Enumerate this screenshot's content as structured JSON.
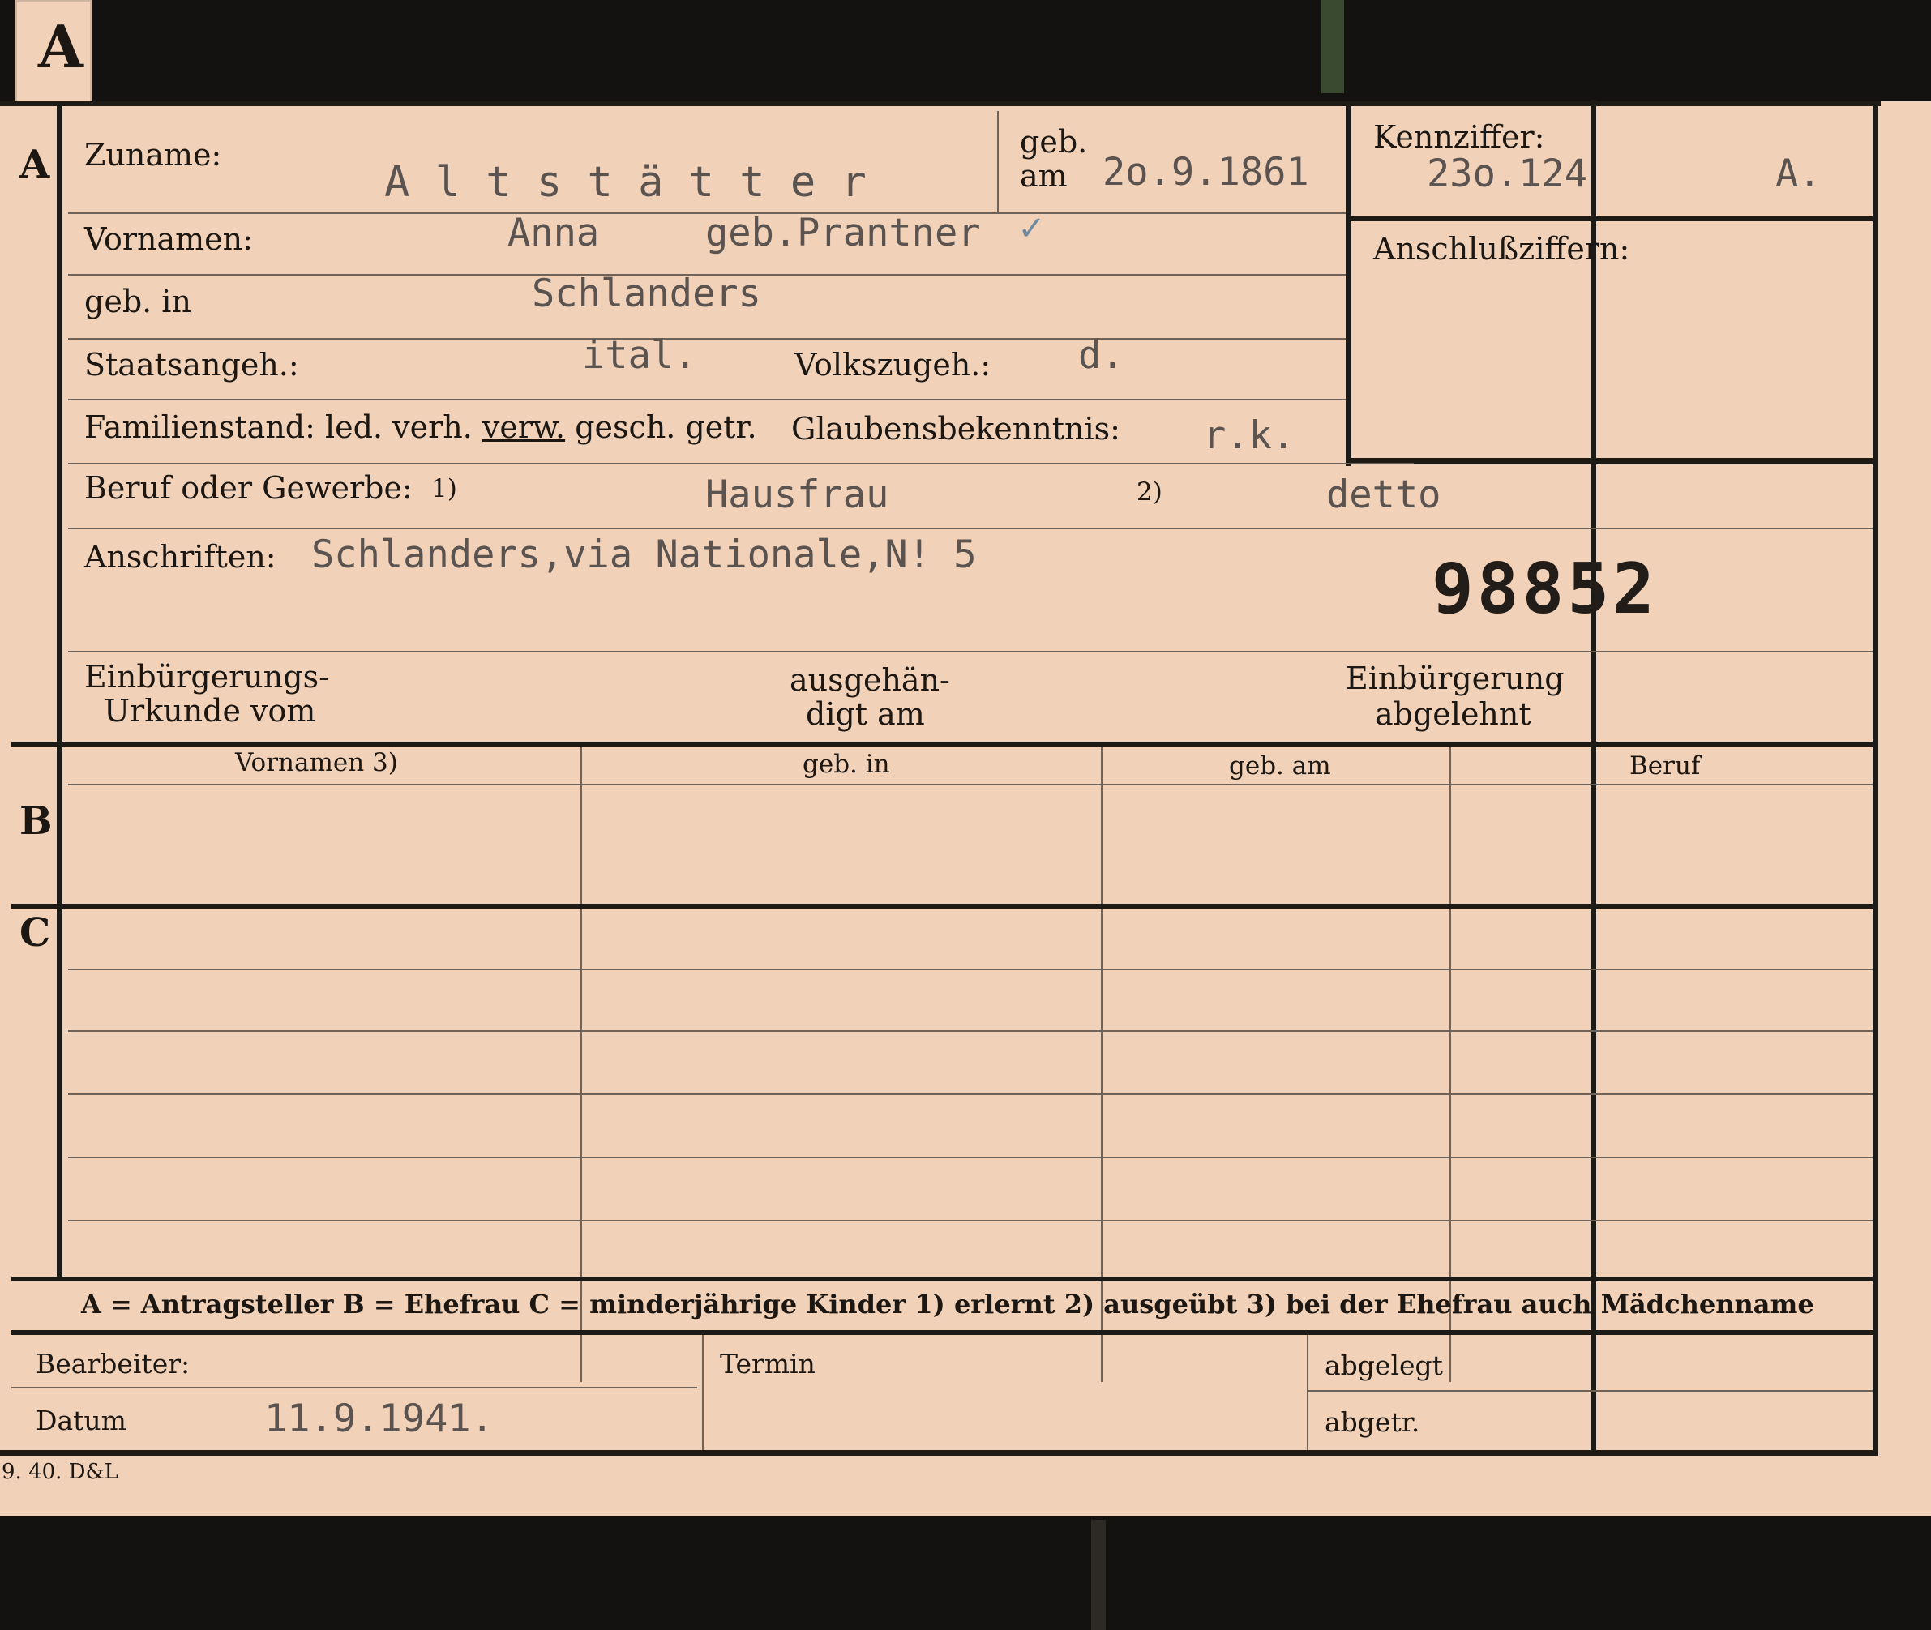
{
  "tab": {
    "letter": "A"
  },
  "sections": {
    "a": "A",
    "b": "B",
    "c": "C"
  },
  "header": {
    "zuname_label": "Zuname:",
    "zuname_value": "A l t s t ä t t e r",
    "geb_label1": "geb.",
    "geb_label2": "am",
    "geb_value": "2o.9.1861",
    "kennziffer_label": "Kennziffer:",
    "kennziffer_value": "23o.124",
    "kennziffer_suffix": "A.",
    "anschluss_label": "Anschlußziffern:"
  },
  "fields": {
    "vornamen_label": "Vornamen:",
    "vornamen_value": "Anna",
    "vornamen_value2": "geb.Prantner",
    "vornamen_check": "✓",
    "gebin_label": "geb. in",
    "gebin_value": "Schlanders",
    "staat_label": "Staatsangeh.:",
    "staat_value": "ital.",
    "volk_label": "Volkszugeh.:",
    "volk_value": "d.",
    "famstand_label": "Familienstand: led. verh.",
    "famstand_marked": "verw.",
    "famstand_rest": "gesch. getr.",
    "glauben_label": "Glaubensbekenntnis:",
    "glauben_value": "r.k.",
    "beruf_label": "Beruf oder Gewerbe:",
    "beruf_note1": "1)",
    "beruf_value1": "Hausfrau",
    "beruf_note2": "2)",
    "beruf_value2": "detto",
    "anschrift_label": "Anschriften:",
    "anschrift_value": "Schlanders,via Nationale,N! 5",
    "number": "98852",
    "einb_label1": "Einbürgerungs-",
    "einb_label2": "Urkunde vom",
    "ausg_label1": "ausgehän-",
    "ausg_label2": "digt am",
    "abgel_label1": "Einbürgerung",
    "abgel_label2": "abgelehnt"
  },
  "table": {
    "headers": [
      "Vornamen 3)",
      "geb. in",
      "geb. am",
      "Beruf"
    ]
  },
  "legend": "A = Antragsteller   B = Ehefrau   C = minderjährige Kinder   1) erlernt   2) ausgeübt   3) bei der Ehefrau auch Mädchenname",
  "footer": {
    "bearbeiter_label": "Bearbeiter:",
    "datum_label": "Datum",
    "datum_value": "11.9.1941.",
    "termin_label": "Termin",
    "abgelegt_label": "abgelegt",
    "abgetr_label": "abgetr.",
    "print_code": "9. 40. D&L"
  }
}
